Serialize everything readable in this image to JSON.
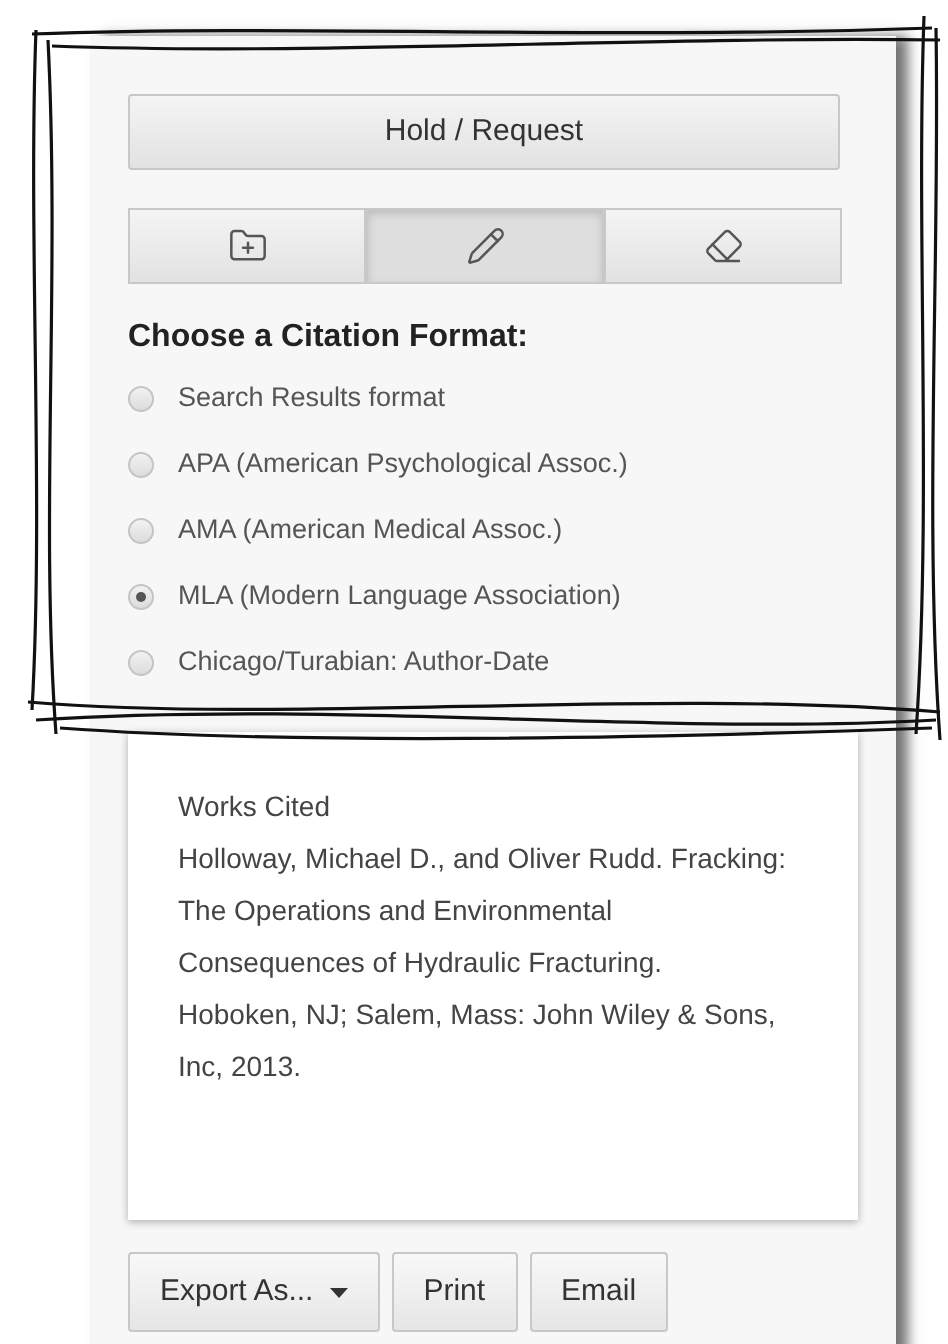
{
  "hold_button": {
    "label": "Hold / Request"
  },
  "tool_tabs": [
    {
      "kind": "folder-add",
      "selected": false
    },
    {
      "kind": "edit",
      "selected": true
    },
    {
      "kind": "erase",
      "selected": false
    }
  ],
  "citation_heading": "Choose a Citation Format:",
  "formats": [
    {
      "label": "Search Results format",
      "selected": false
    },
    {
      "label": "APA (American Psychological Assoc.)",
      "selected": false
    },
    {
      "label": "AMA (American Medical Assoc.)",
      "selected": false
    },
    {
      "label": "MLA (Modern Language Association)",
      "selected": true
    },
    {
      "label": "Chicago/Turabian: Author-Date",
      "selected": false
    }
  ],
  "citation": {
    "title": "Works Cited",
    "text": "Holloway, Michael D., and Oliver Rudd. Fracking: The Operations and Environmental Consequences of Hydraulic Fracturing. Hoboken, NJ; Salem, Mass: John Wiley & Sons, Inc, 2013."
  },
  "actions": [
    {
      "label": "Export As...",
      "kind": "dropdown"
    },
    {
      "label": "Print",
      "kind": "button"
    },
    {
      "label": "Email",
      "kind": "button"
    }
  ]
}
